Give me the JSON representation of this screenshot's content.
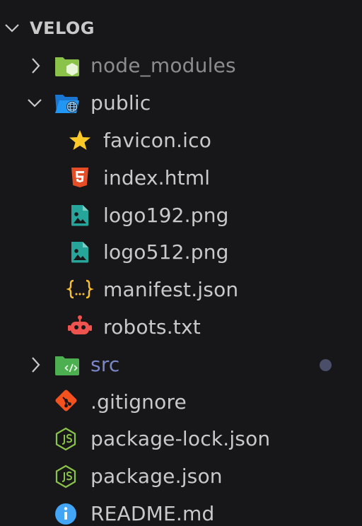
{
  "section": {
    "title": "VELOG",
    "expanded": true
  },
  "tree": {
    "node_modules": "node_modules",
    "public": "public",
    "favicon": "favicon.ico",
    "index_html": "index.html",
    "logo192": "logo192.png",
    "logo512": "logo512.png",
    "manifest": "manifest.json",
    "robots": "robots.txt",
    "src": "src",
    "gitignore": ".gitignore",
    "package_lock": "package-lock.json",
    "package_json": "package.json",
    "readme": "README.md"
  },
  "icons": {
    "node_modules": "node-folder-icon",
    "public": "public-folder-icon",
    "favicon": "star-icon",
    "index_html": "html5-icon",
    "logo192": "image-file-icon",
    "logo512": "image-file-icon",
    "manifest": "json-braces-icon",
    "robots": "robot-icon",
    "src": "src-folder-icon",
    "gitignore": "git-icon",
    "package_lock": "nodejs-icon",
    "package_json": "nodejs-icon",
    "readme": "info-icon"
  },
  "colors": {
    "background": "#17171a",
    "text": "#c9c9c9",
    "ignored_text": "#8c8c8c",
    "modified_text": "#7a86c6",
    "modified_dot": "#4a4e68",
    "folder_green": "#8bc34a",
    "folder_blue": "#2196f3",
    "html_orange": "#e44d26",
    "image_teal": "#26a69a",
    "json_yellow": "#fbc02d",
    "robot_red": "#ef5350",
    "git_orange": "#f4511e",
    "node_green": "#8bc34a",
    "info_blue": "#42a5f5",
    "star_yellow": "#ffca28"
  }
}
